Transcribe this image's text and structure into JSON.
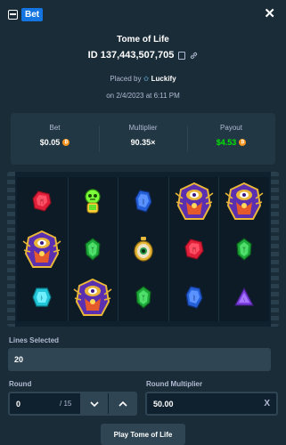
{
  "header": {
    "tag_label": "Bet",
    "close_icon": "close-icon"
  },
  "bet": {
    "game_title": "Tome of Life",
    "id_text": "ID 137,443,507,705",
    "placed_prefix": "Placed by",
    "placed_user": "Luckify",
    "date_text": "on 2/4/2023 at 6:11 PM"
  },
  "stats": {
    "bet_label": "Bet",
    "bet_value": "$0.05",
    "multiplier_label": "Multiplier",
    "multiplier_value": "90.35×",
    "payout_label": "Payout",
    "payout_value": "$4.53"
  },
  "board": {
    "reels": [
      [
        "red-gem",
        "pharaoh",
        "cyan-gem"
      ],
      [
        "green-potion",
        "green-gem",
        "pharaoh"
      ],
      [
        "blue-gem",
        "eye-amulet",
        "green-gem"
      ],
      [
        "pharaoh",
        "red-gem",
        "blue-gem"
      ],
      [
        "pharaoh",
        "green-gem",
        "purple-gem"
      ]
    ]
  },
  "controls": {
    "lines_label": "Lines Selected",
    "lines_value": "20",
    "round_label": "Round",
    "round_value": "0",
    "round_total": "/ 15",
    "round_multiplier_label": "Round Multiplier",
    "round_multiplier_value": "50.00",
    "clear_symbol": "X",
    "play_button": "Play Tome of Life"
  },
  "colors": {
    "background": "#1a2c38",
    "panel": "#213743",
    "input": "#2f4553",
    "accent_blue": "#1475e1",
    "payout_green": "#00e701",
    "coin": "#f7931a"
  }
}
